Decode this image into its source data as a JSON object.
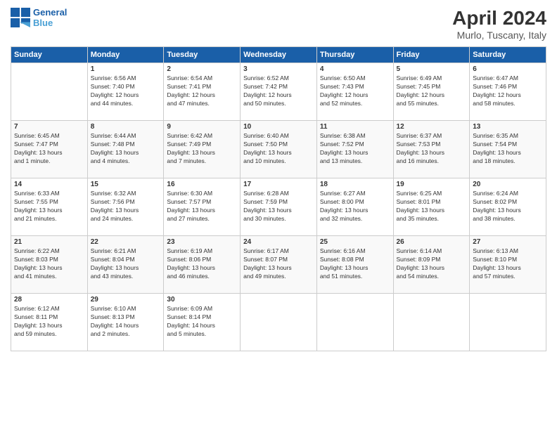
{
  "logo": {
    "line1": "General",
    "line2": "Blue"
  },
  "title": "April 2024",
  "subtitle": "Murlo, Tuscany, Italy",
  "weekdays": [
    "Sunday",
    "Monday",
    "Tuesday",
    "Wednesday",
    "Thursday",
    "Friday",
    "Saturday"
  ],
  "weeks": [
    [
      {
        "day": "",
        "info": ""
      },
      {
        "day": "1",
        "info": "Sunrise: 6:56 AM\nSunset: 7:40 PM\nDaylight: 12 hours\nand 44 minutes."
      },
      {
        "day": "2",
        "info": "Sunrise: 6:54 AM\nSunset: 7:41 PM\nDaylight: 12 hours\nand 47 minutes."
      },
      {
        "day": "3",
        "info": "Sunrise: 6:52 AM\nSunset: 7:42 PM\nDaylight: 12 hours\nand 50 minutes."
      },
      {
        "day": "4",
        "info": "Sunrise: 6:50 AM\nSunset: 7:43 PM\nDaylight: 12 hours\nand 52 minutes."
      },
      {
        "day": "5",
        "info": "Sunrise: 6:49 AM\nSunset: 7:45 PM\nDaylight: 12 hours\nand 55 minutes."
      },
      {
        "day": "6",
        "info": "Sunrise: 6:47 AM\nSunset: 7:46 PM\nDaylight: 12 hours\nand 58 minutes."
      }
    ],
    [
      {
        "day": "7",
        "info": "Sunrise: 6:45 AM\nSunset: 7:47 PM\nDaylight: 13 hours\nand 1 minute."
      },
      {
        "day": "8",
        "info": "Sunrise: 6:44 AM\nSunset: 7:48 PM\nDaylight: 13 hours\nand 4 minutes."
      },
      {
        "day": "9",
        "info": "Sunrise: 6:42 AM\nSunset: 7:49 PM\nDaylight: 13 hours\nand 7 minutes."
      },
      {
        "day": "10",
        "info": "Sunrise: 6:40 AM\nSunset: 7:50 PM\nDaylight: 13 hours\nand 10 minutes."
      },
      {
        "day": "11",
        "info": "Sunrise: 6:38 AM\nSunset: 7:52 PM\nDaylight: 13 hours\nand 13 minutes."
      },
      {
        "day": "12",
        "info": "Sunrise: 6:37 AM\nSunset: 7:53 PM\nDaylight: 13 hours\nand 16 minutes."
      },
      {
        "day": "13",
        "info": "Sunrise: 6:35 AM\nSunset: 7:54 PM\nDaylight: 13 hours\nand 18 minutes."
      }
    ],
    [
      {
        "day": "14",
        "info": "Sunrise: 6:33 AM\nSunset: 7:55 PM\nDaylight: 13 hours\nand 21 minutes."
      },
      {
        "day": "15",
        "info": "Sunrise: 6:32 AM\nSunset: 7:56 PM\nDaylight: 13 hours\nand 24 minutes."
      },
      {
        "day": "16",
        "info": "Sunrise: 6:30 AM\nSunset: 7:57 PM\nDaylight: 13 hours\nand 27 minutes."
      },
      {
        "day": "17",
        "info": "Sunrise: 6:28 AM\nSunset: 7:59 PM\nDaylight: 13 hours\nand 30 minutes."
      },
      {
        "day": "18",
        "info": "Sunrise: 6:27 AM\nSunset: 8:00 PM\nDaylight: 13 hours\nand 32 minutes."
      },
      {
        "day": "19",
        "info": "Sunrise: 6:25 AM\nSunset: 8:01 PM\nDaylight: 13 hours\nand 35 minutes."
      },
      {
        "day": "20",
        "info": "Sunrise: 6:24 AM\nSunset: 8:02 PM\nDaylight: 13 hours\nand 38 minutes."
      }
    ],
    [
      {
        "day": "21",
        "info": "Sunrise: 6:22 AM\nSunset: 8:03 PM\nDaylight: 13 hours\nand 41 minutes."
      },
      {
        "day": "22",
        "info": "Sunrise: 6:21 AM\nSunset: 8:04 PM\nDaylight: 13 hours\nand 43 minutes."
      },
      {
        "day": "23",
        "info": "Sunrise: 6:19 AM\nSunset: 8:06 PM\nDaylight: 13 hours\nand 46 minutes."
      },
      {
        "day": "24",
        "info": "Sunrise: 6:17 AM\nSunset: 8:07 PM\nDaylight: 13 hours\nand 49 minutes."
      },
      {
        "day": "25",
        "info": "Sunrise: 6:16 AM\nSunset: 8:08 PM\nDaylight: 13 hours\nand 51 minutes."
      },
      {
        "day": "26",
        "info": "Sunrise: 6:14 AM\nSunset: 8:09 PM\nDaylight: 13 hours\nand 54 minutes."
      },
      {
        "day": "27",
        "info": "Sunrise: 6:13 AM\nSunset: 8:10 PM\nDaylight: 13 hours\nand 57 minutes."
      }
    ],
    [
      {
        "day": "28",
        "info": "Sunrise: 6:12 AM\nSunset: 8:11 PM\nDaylight: 13 hours\nand 59 minutes."
      },
      {
        "day": "29",
        "info": "Sunrise: 6:10 AM\nSunset: 8:13 PM\nDaylight: 14 hours\nand 2 minutes."
      },
      {
        "day": "30",
        "info": "Sunrise: 6:09 AM\nSunset: 8:14 PM\nDaylight: 14 hours\nand 5 minutes."
      },
      {
        "day": "",
        "info": ""
      },
      {
        "day": "",
        "info": ""
      },
      {
        "day": "",
        "info": ""
      },
      {
        "day": "",
        "info": ""
      }
    ]
  ]
}
